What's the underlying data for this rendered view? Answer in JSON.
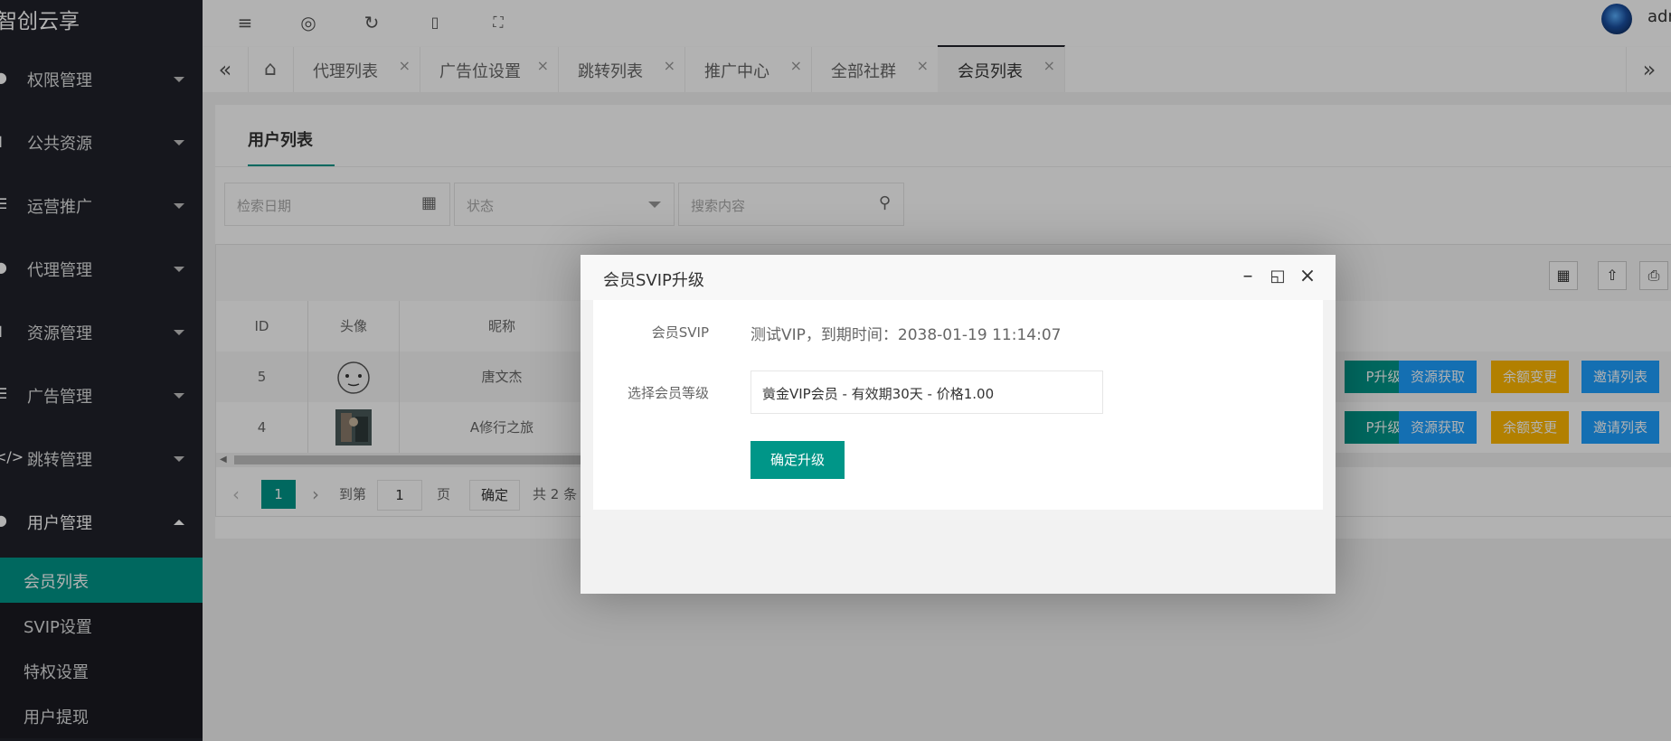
{
  "app": {
    "logo": "智创云享",
    "admin": "admin"
  },
  "sidebar": {
    "items": [
      {
        "label": "权限管理",
        "icon": "user-lock-icon"
      },
      {
        "label": "公共资源",
        "icon": "book-icon"
      },
      {
        "label": "运营推广",
        "icon": "list-icon"
      },
      {
        "label": "代理管理",
        "icon": "users-icon"
      },
      {
        "label": "资源管理",
        "icon": "folder-icon"
      },
      {
        "label": "广告管理",
        "icon": "list-icon"
      },
      {
        "label": "跳转管理",
        "icon": "code-icon"
      },
      {
        "label": "用户管理",
        "icon": "user-icon"
      }
    ],
    "subitems": [
      {
        "label": "会员列表",
        "active": true
      },
      {
        "label": "SVIP设置"
      },
      {
        "label": "特权设置"
      },
      {
        "label": "用户提现"
      }
    ]
  },
  "header": {
    "icons": [
      "menu-fold-icon",
      "globe-icon",
      "refresh-icon",
      "trash-icon",
      "fullscreen-icon"
    ]
  },
  "tabs": [
    {
      "label": "代理列表"
    },
    {
      "label": "广告位设置"
    },
    {
      "label": "跳转列表"
    },
    {
      "label": "推广中心"
    },
    {
      "label": "全部社群"
    },
    {
      "label": "会员列表",
      "active": true
    }
  ],
  "page": {
    "card_tab": "用户列表",
    "filters": {
      "date_placeholder": "检索日期",
      "status_placeholder": "状态",
      "search_placeholder": "搜索内容"
    },
    "table": {
      "headers": [
        "ID",
        "头像",
        "昵称"
      ],
      "rows": [
        {
          "id": "5",
          "nickname": "唐文杰"
        },
        {
          "id": "4",
          "nickname": "A修行之旅"
        }
      ],
      "row_buttons": [
        "P升级",
        "资源获取",
        "余额变更",
        "邀请列表"
      ]
    },
    "pager": {
      "current": "1",
      "goto_label": "到第",
      "goto_value": "1",
      "page_unit": "页",
      "confirm": "确定",
      "total": "共 2 条"
    }
  },
  "dialog": {
    "title": "会员SVIP升级",
    "svip_label": "会员SVIP",
    "svip_value": "测试VIP，到期时间：2038-01-19 11:14:07",
    "level_label": "选择会员等级",
    "level_value": "黄金VIP会员 - 有效期30天 - 价格1.00",
    "confirm_button": "确定升级"
  },
  "colors": {
    "sidebar_bg": "#20222a",
    "accent": "#009688",
    "blue": "#1e9fff",
    "orange": "#ffb800"
  }
}
